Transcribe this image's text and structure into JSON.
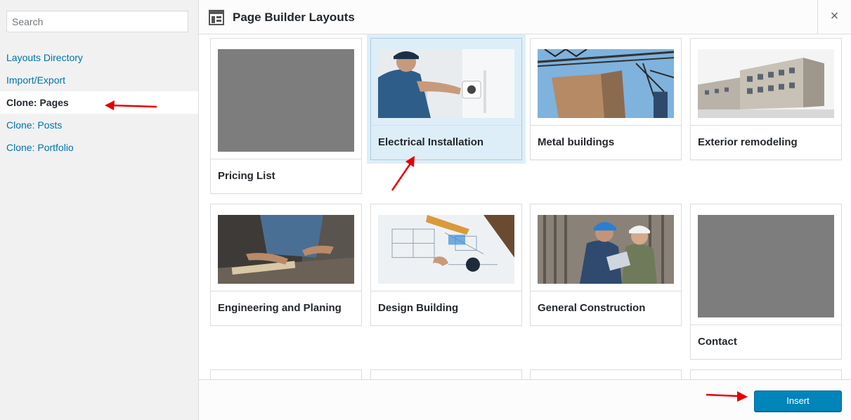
{
  "sidebar": {
    "search_placeholder": "Search",
    "items": [
      {
        "label": "Layouts Directory"
      },
      {
        "label": "Import/Export"
      },
      {
        "label": "Clone: Pages",
        "active": true
      },
      {
        "label": "Clone: Posts"
      },
      {
        "label": "Clone: Portfolio"
      }
    ]
  },
  "header": {
    "title": "Page Builder Layouts",
    "close_symbol": "×"
  },
  "layouts": [
    {
      "label": "Pricing List",
      "image": "gray-placeholder"
    },
    {
      "label": "Electrical Installation",
      "image": "electrician-photo",
      "selected": true
    },
    {
      "label": "Metal buildings",
      "image": "construction-tower-photo"
    },
    {
      "label": "Exterior remodeling",
      "image": "building-rendering"
    },
    {
      "label": "Engineering and Planing",
      "image": "carpenter-photo"
    },
    {
      "label": "Design Building",
      "image": "blueprints-photo"
    },
    {
      "label": "General Construction",
      "image": "workers-tablet-photo"
    },
    {
      "label": "Contact",
      "image": "gray-placeholder"
    }
  ],
  "footer": {
    "insert_label": "Insert"
  },
  "colors": {
    "accent": "#0085ba",
    "link": "#0073aa",
    "annotation_arrow": "#e60000",
    "selected_bg": "#ddeef8"
  }
}
